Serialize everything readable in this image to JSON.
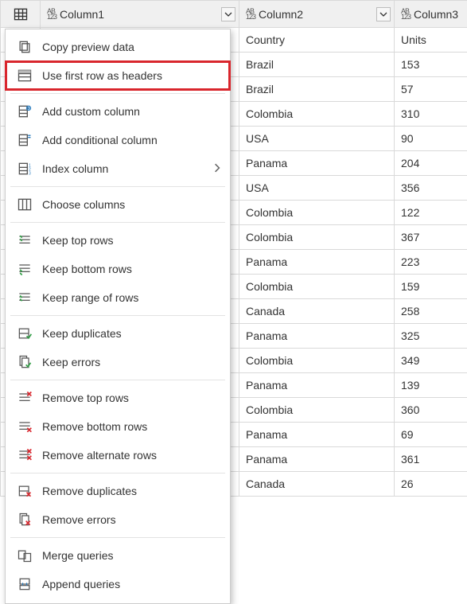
{
  "columns": {
    "col1": "Column1",
    "col2": "Column2",
    "col3": "Column3"
  },
  "rows": [
    {
      "c2": "Country",
      "c3": "Units"
    },
    {
      "c2": "Brazil",
      "c3": "153"
    },
    {
      "c2": "Brazil",
      "c3": "57"
    },
    {
      "c2": "Colombia",
      "c3": "310"
    },
    {
      "c2": "USA",
      "c3": "90"
    },
    {
      "c2": "Panama",
      "c3": "204"
    },
    {
      "c2": "USA",
      "c3": "356"
    },
    {
      "c2": "Colombia",
      "c3": "122"
    },
    {
      "c2": "Colombia",
      "c3": "367"
    },
    {
      "c2": "Panama",
      "c3": "223"
    },
    {
      "c2": "Colombia",
      "c3": "159"
    },
    {
      "c2": "Canada",
      "c3": "258"
    },
    {
      "c2": "Panama",
      "c3": "325"
    },
    {
      "c2": "Colombia",
      "c3": "349"
    },
    {
      "c2": "Panama",
      "c3": "139"
    },
    {
      "c2": "Colombia",
      "c3": "360"
    },
    {
      "c2": "Panama",
      "c3": "69"
    },
    {
      "c2": "Panama",
      "c3": "361"
    },
    {
      "c2": "Canada",
      "c3": "26"
    }
  ],
  "menu": {
    "copy_preview": "Copy preview data",
    "use_first_row": "Use first row as headers",
    "add_custom_col": "Add custom column",
    "add_conditional_col": "Add conditional column",
    "index_column": "Index column",
    "choose_columns": "Choose columns",
    "keep_top": "Keep top rows",
    "keep_bottom": "Keep bottom rows",
    "keep_range": "Keep range of rows",
    "keep_duplicates": "Keep duplicates",
    "keep_errors": "Keep errors",
    "remove_top": "Remove top rows",
    "remove_bottom": "Remove bottom rows",
    "remove_alternate": "Remove alternate rows",
    "remove_duplicates": "Remove duplicates",
    "remove_errors": "Remove errors",
    "merge_queries": "Merge queries",
    "append_queries": "Append queries"
  }
}
